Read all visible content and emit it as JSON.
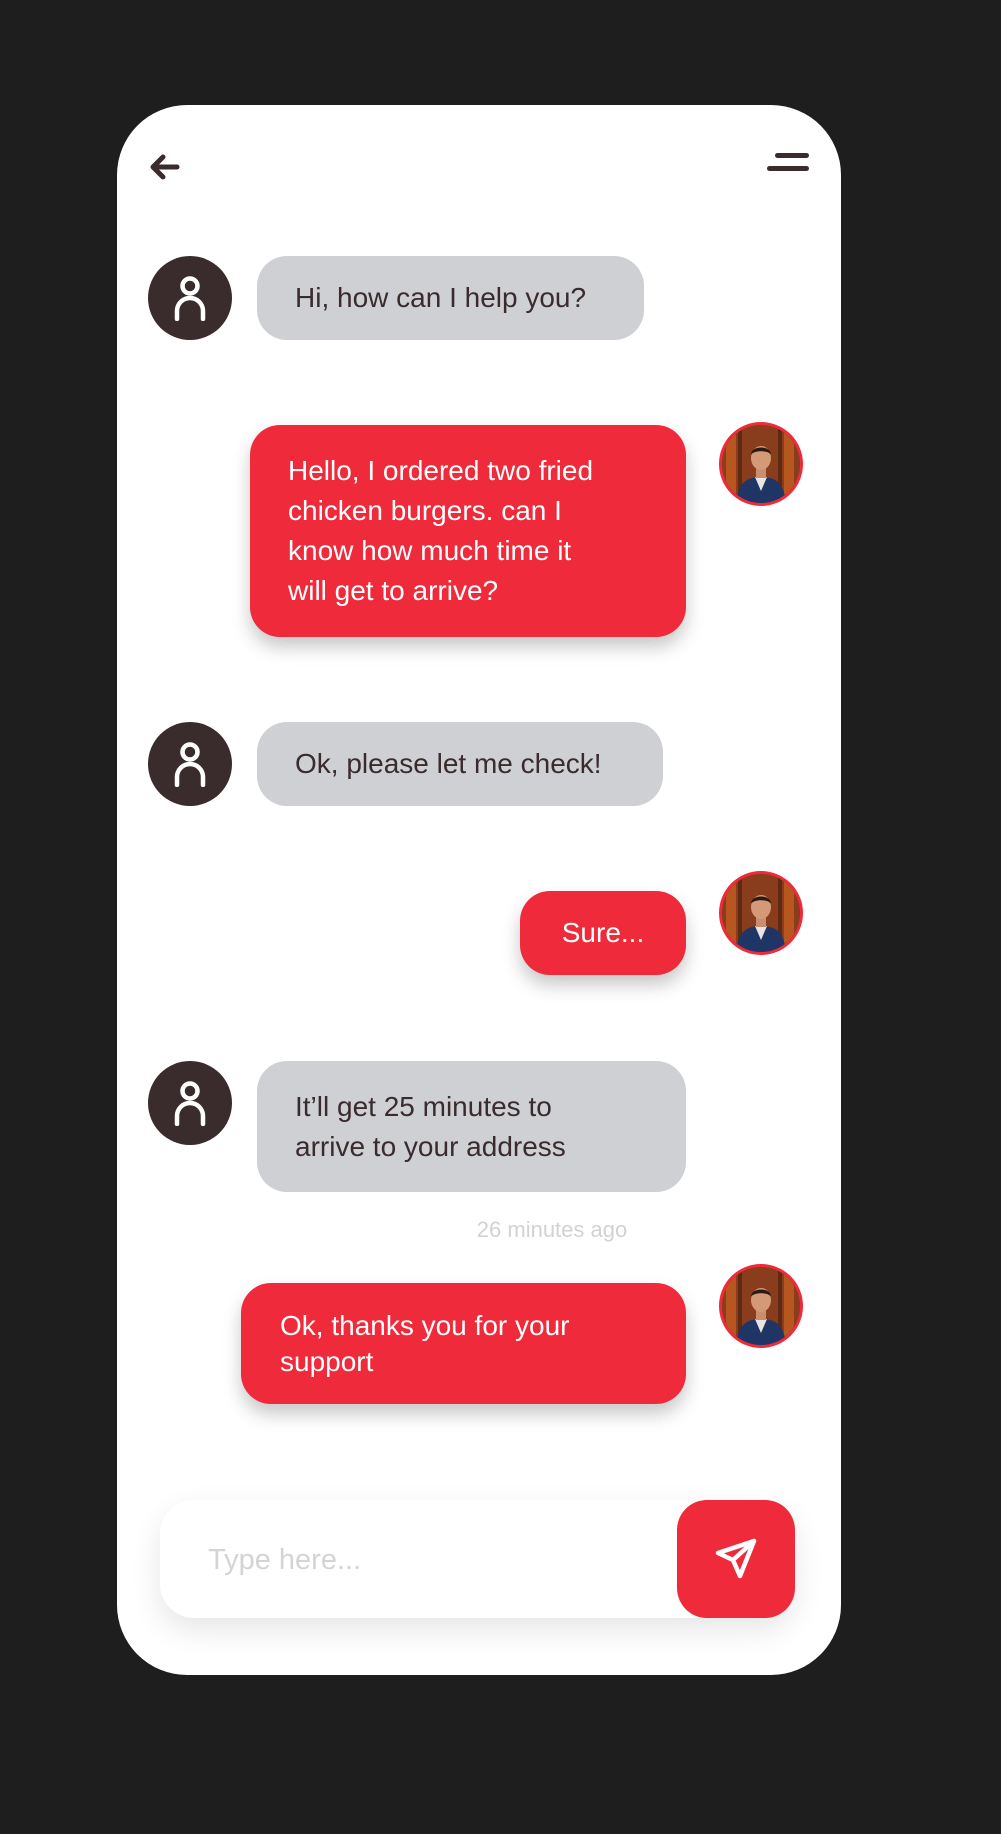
{
  "header": {
    "back_icon": "arrow-left-icon",
    "menu_icon": "menu-lines-icon"
  },
  "colors": {
    "accent": "#ee2a3b",
    "dark": "#3a2b2c",
    "bot_bubble": "#cfd0d4",
    "background": "#1e1e1e"
  },
  "messages": [
    {
      "sender": "support",
      "text": "Hi, how can I help you?"
    },
    {
      "sender": "user",
      "lines": [
        "Hello, I ordered two fried",
        "chicken burgers. can I",
        "know how much time it",
        "will get to arrive?"
      ]
    },
    {
      "sender": "support",
      "text": "Ok, please let me check!"
    },
    {
      "sender": "user",
      "text": "Sure..."
    },
    {
      "sender": "support",
      "lines": [
        "It’ll get 25 minutes to",
        "arrive to your address"
      ]
    },
    {
      "sender": "user",
      "lines": [
        "Ok, thanks you for your",
        "support"
      ]
    }
  ],
  "timestamp": "26 minutes ago",
  "composer": {
    "placeholder": "Type here...",
    "send_icon": "paper-plane-icon"
  }
}
